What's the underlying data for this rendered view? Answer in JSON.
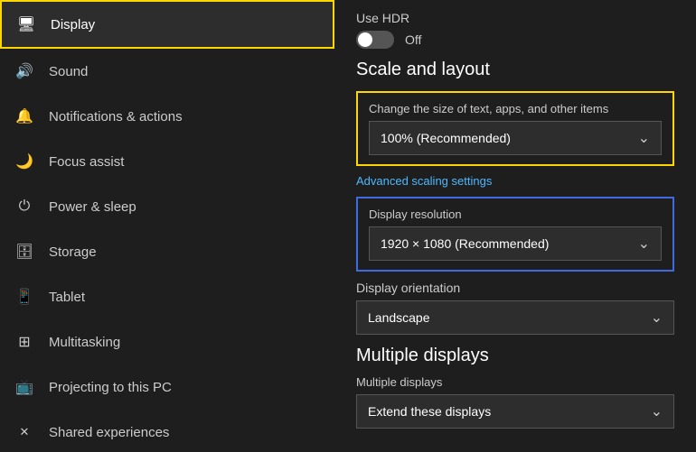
{
  "sidebar": {
    "items": [
      {
        "id": "display",
        "label": "Display",
        "icon": "🖥",
        "active": true
      },
      {
        "id": "sound",
        "label": "Sound",
        "icon": "🔊",
        "active": false
      },
      {
        "id": "notifications",
        "label": "Notifications & actions",
        "icon": "🔔",
        "active": false
      },
      {
        "id": "focus",
        "label": "Focus assist",
        "icon": "🌙",
        "active": false
      },
      {
        "id": "power",
        "label": "Power & sleep",
        "icon": "⏻",
        "active": false
      },
      {
        "id": "storage",
        "label": "Storage",
        "icon": "🗄",
        "active": false
      },
      {
        "id": "tablet",
        "label": "Tablet",
        "icon": "📱",
        "active": false
      },
      {
        "id": "multitasking",
        "label": "Multitasking",
        "icon": "⊞",
        "active": false
      },
      {
        "id": "projecting",
        "label": "Projecting to this PC",
        "icon": "📺",
        "active": false
      },
      {
        "id": "shared",
        "label": "Shared experiences",
        "icon": "✕",
        "active": false
      }
    ]
  },
  "main": {
    "hdr_label": "Use HDR",
    "hdr_value": "Off",
    "scale_section_title": "Scale and layout",
    "scale_box_label": "Change the size of text, apps, and other items",
    "scale_selected": "100% (Recommended)",
    "advanced_link": "Advanced scaling settings",
    "resolution_label": "Display resolution",
    "resolution_selected": "1920 × 1080 (Recommended)",
    "orientation_label": "Display orientation",
    "orientation_selected": "Landscape",
    "multiple_displays_title": "Multiple displays",
    "multiple_displays_label": "Multiple displays",
    "multiple_displays_selected": "Extend these displays"
  }
}
